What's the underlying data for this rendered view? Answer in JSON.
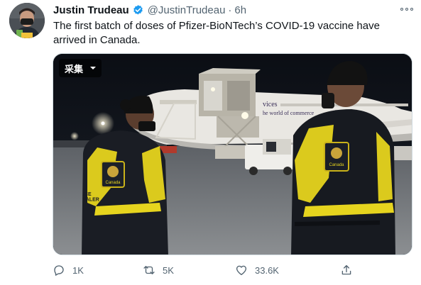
{
  "author": {
    "display_name": "Justin Trudeau",
    "handle": "@JustinTrudeau",
    "separator": "·",
    "time": "6h"
  },
  "tweet": {
    "text": "The first batch of doses of Pfizer-BioNTech’s COVID-19 vaccine have arrived in Canada."
  },
  "media": {
    "language_tag": "采集",
    "plane_livery_line1": "vices",
    "plane_livery_line2": "he world of commerce",
    "vest_patch_text": "Canada",
    "vest_side_text": "ICE\nTALER"
  },
  "actions": {
    "reply_count": "1K",
    "retweet_count": "5K",
    "like_count": "33.6K"
  },
  "colors": {
    "verified_blue": "#1d9bf0",
    "secondary_text": "#536471",
    "vest_yellow": "#e6d41e"
  }
}
